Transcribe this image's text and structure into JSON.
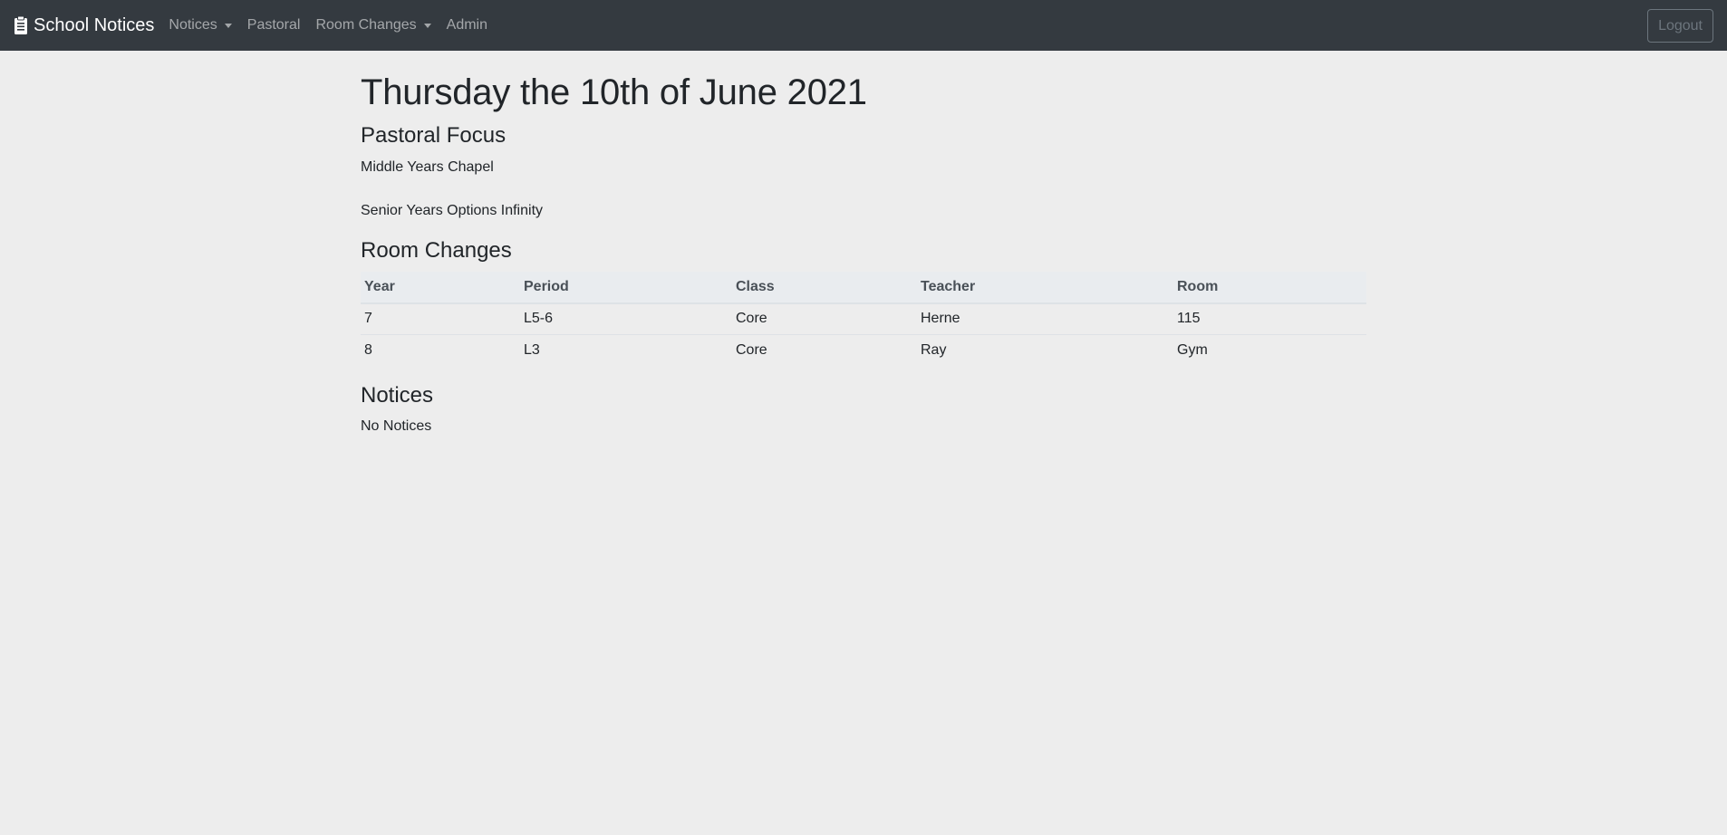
{
  "navbar": {
    "brand_icon": "clipboard-icon",
    "brand": "School Notices",
    "links": [
      {
        "label": "Notices",
        "dropdown": true
      },
      {
        "label": "Pastoral",
        "dropdown": false
      },
      {
        "label": "Room Changes",
        "dropdown": true
      },
      {
        "label": "Admin",
        "dropdown": false
      }
    ],
    "logout_label": "Logout",
    "background": "#343a40"
  },
  "page": {
    "title": "Thursday the 10th of June 2021",
    "pastoral": {
      "heading": "Pastoral Focus",
      "items": [
        "Middle Years Chapel",
        "Senior Years Options Infinity"
      ]
    },
    "room_changes": {
      "heading": "Room Changes",
      "columns": [
        "Year",
        "Period",
        "Class",
        "Teacher",
        "Room"
      ],
      "rows": [
        [
          "7",
          "L5-6",
          "Core",
          "Herne",
          "115"
        ],
        [
          "8",
          "L3",
          "Core",
          "Ray",
          "Gym"
        ]
      ]
    },
    "notices": {
      "heading": "Notices",
      "empty_text": "No Notices"
    }
  }
}
